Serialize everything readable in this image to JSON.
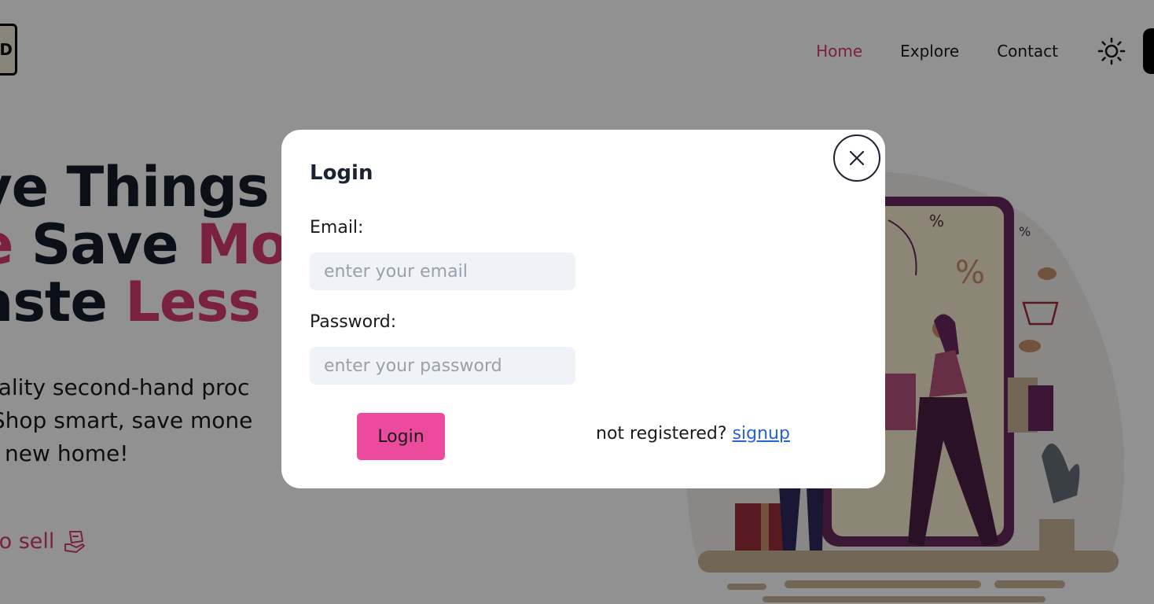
{
  "brand": {
    "logo_letter": "D"
  },
  "nav": {
    "items": [
      {
        "label": "Home"
      },
      {
        "label": "Explore"
      },
      {
        "label": "Contact"
      }
    ]
  },
  "hero": {
    "line1": "ve Things o",
    "line2_pink_start": "e",
    "line2_dark": " Save ",
    "line2_pink_end": "Mor",
    "line3_dark": "aste ",
    "line3_pink": "Less",
    "desc1": "uality second-hand proc",
    "desc2": " Shop smart, save mone",
    "desc3": "a new home!",
    "sell_cta": "to sell"
  },
  "illustration": {
    "tag1": "%",
    "tag2": "%",
    "tag3": "%"
  },
  "modal": {
    "title": "Login",
    "email_label": "Email:",
    "email_placeholder": "enter your email",
    "email_value": "",
    "password_label": "Password:",
    "password_placeholder": "enter your password",
    "password_value": "",
    "login_button": "Login",
    "register_prompt": "not registered? ",
    "signup_link": "signup"
  },
  "colors": {
    "accent": "#d63a72",
    "button": "#ec4b9d",
    "link": "#2563d8",
    "input_bg": "#eff2f6"
  }
}
